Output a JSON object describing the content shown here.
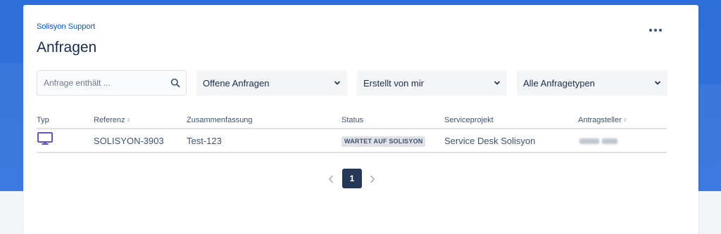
{
  "breadcrumb": "Solisyon Support",
  "title": "Anfragen",
  "more_icon": "more-horizontal-icon",
  "filters": {
    "search_placeholder": "Anfrage enthält ...",
    "search_icon": "search-icon",
    "status_select": "Offene Anfragen",
    "creator_select": "Erstellt von mir",
    "type_select": "Alle Anfragetypen"
  },
  "table": {
    "columns": [
      "Typ",
      "Referenz",
      "Zusammenfassung",
      "Status",
      "Serviceprojekt",
      "Antragsteller"
    ],
    "rows": [
      {
        "type_icon": "computer-monitor-icon",
        "reference": "SOLISYON-3903",
        "summary": "Test-123",
        "status": "WARTET AUF SOLISYON",
        "project": "Service Desk Solisyon",
        "requester": ""
      }
    ]
  },
  "pagination": {
    "current_page": "1"
  },
  "colors": {
    "background_blue": "#2e6ed8",
    "link_blue": "#0052cc",
    "pager_active": "#253858",
    "type_icon": "#6554c0"
  }
}
